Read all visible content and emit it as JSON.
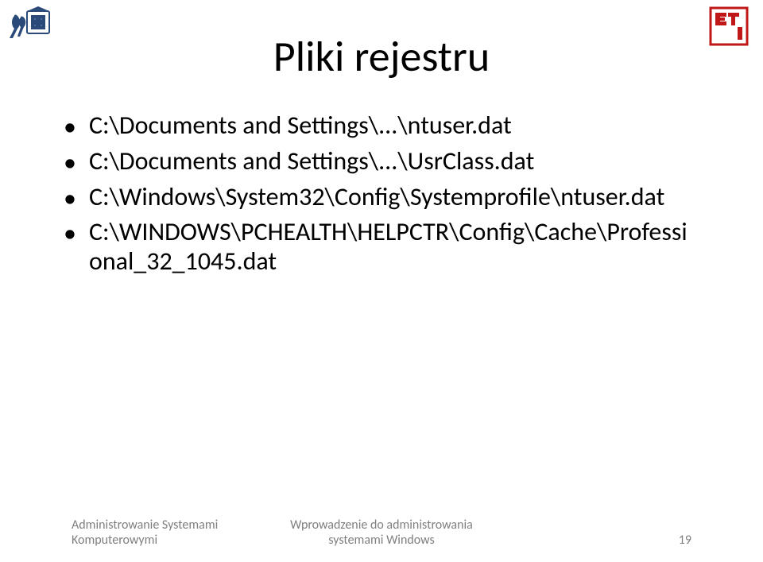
{
  "title": "Pliki rejestru",
  "bullets": [
    "C:\\Documents and Settings\\...\\ntuser.dat",
    "C:\\Documents and Settings\\...\\UsrClass.dat",
    "C:\\Windows\\System32\\Config\\Systemprofile\\ntuser.dat",
    "C:\\WINDOWS\\PCHEALTH\\HELPCTR\\Config\\Cache\\Professional_32_1045.dat"
  ],
  "footer": {
    "left_line1": "Administrowanie Systemami",
    "left_line2": "Komputerowymi",
    "center_line1": "Wprowadzenie do administrowania",
    "center_line2": "systemami Windows",
    "page": "19"
  },
  "logos": {
    "left_color": "#2a4a7a",
    "right_color": "#c01818"
  }
}
